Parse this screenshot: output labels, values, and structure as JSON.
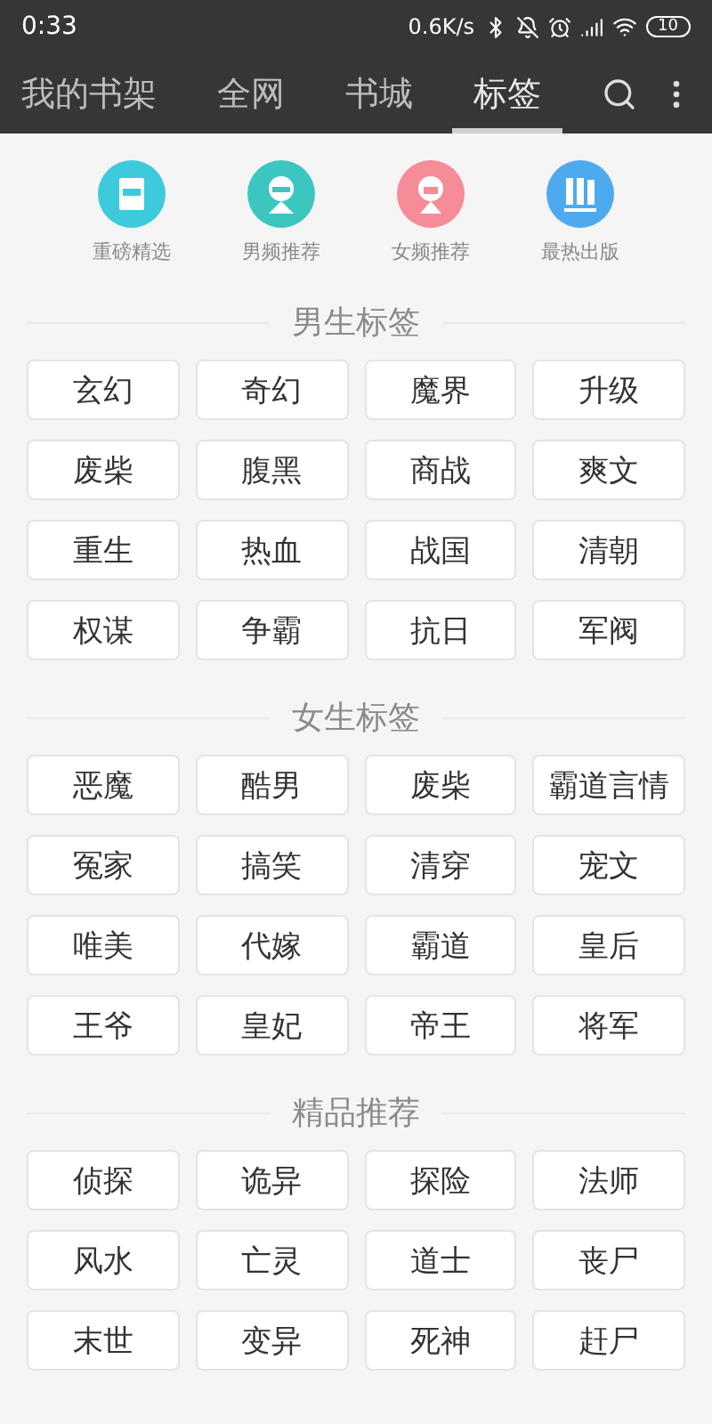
{
  "status_bar": {
    "time": "0:33",
    "speed": "0.6K/s",
    "battery": "10"
  },
  "tabs": [
    {
      "label": "我的书架",
      "selected": false
    },
    {
      "label": "全网",
      "selected": false
    },
    {
      "label": "书城",
      "selected": false
    },
    {
      "label": "标签",
      "selected": true
    }
  ],
  "shortcuts": [
    {
      "label": "重磅精选",
      "kind": "book",
      "color": "#3ccadc"
    },
    {
      "label": "男频推荐",
      "kind": "boy",
      "color": "#3cc6c0"
    },
    {
      "label": "女频推荐",
      "kind": "girl",
      "color": "#f58c98"
    },
    {
      "label": "最热出版",
      "kind": "shelf",
      "color": "#4eaaee"
    }
  ],
  "sections": [
    {
      "title": "男生标签",
      "tags": [
        "玄幻",
        "奇幻",
        "魔界",
        "升级",
        "废柴",
        "腹黑",
        "商战",
        "爽文",
        "重生",
        "热血",
        "战国",
        "清朝",
        "权谋",
        "争霸",
        "抗日",
        "军阀"
      ]
    },
    {
      "title": "女生标签",
      "tags": [
        "恶魔",
        "酷男",
        "废柴",
        "霸道言情",
        "冤家",
        "搞笑",
        "清穿",
        "宠文",
        "唯美",
        "代嫁",
        "霸道",
        "皇后",
        "王爷",
        "皇妃",
        "帝王",
        "将军"
      ]
    },
    {
      "title": "精品推荐",
      "tags": [
        "侦探",
        "诡异",
        "探险",
        "法师",
        "风水",
        "亡灵",
        "道士",
        "丧尸",
        "末世",
        "变异",
        "死神",
        "赶尸"
      ]
    }
  ]
}
